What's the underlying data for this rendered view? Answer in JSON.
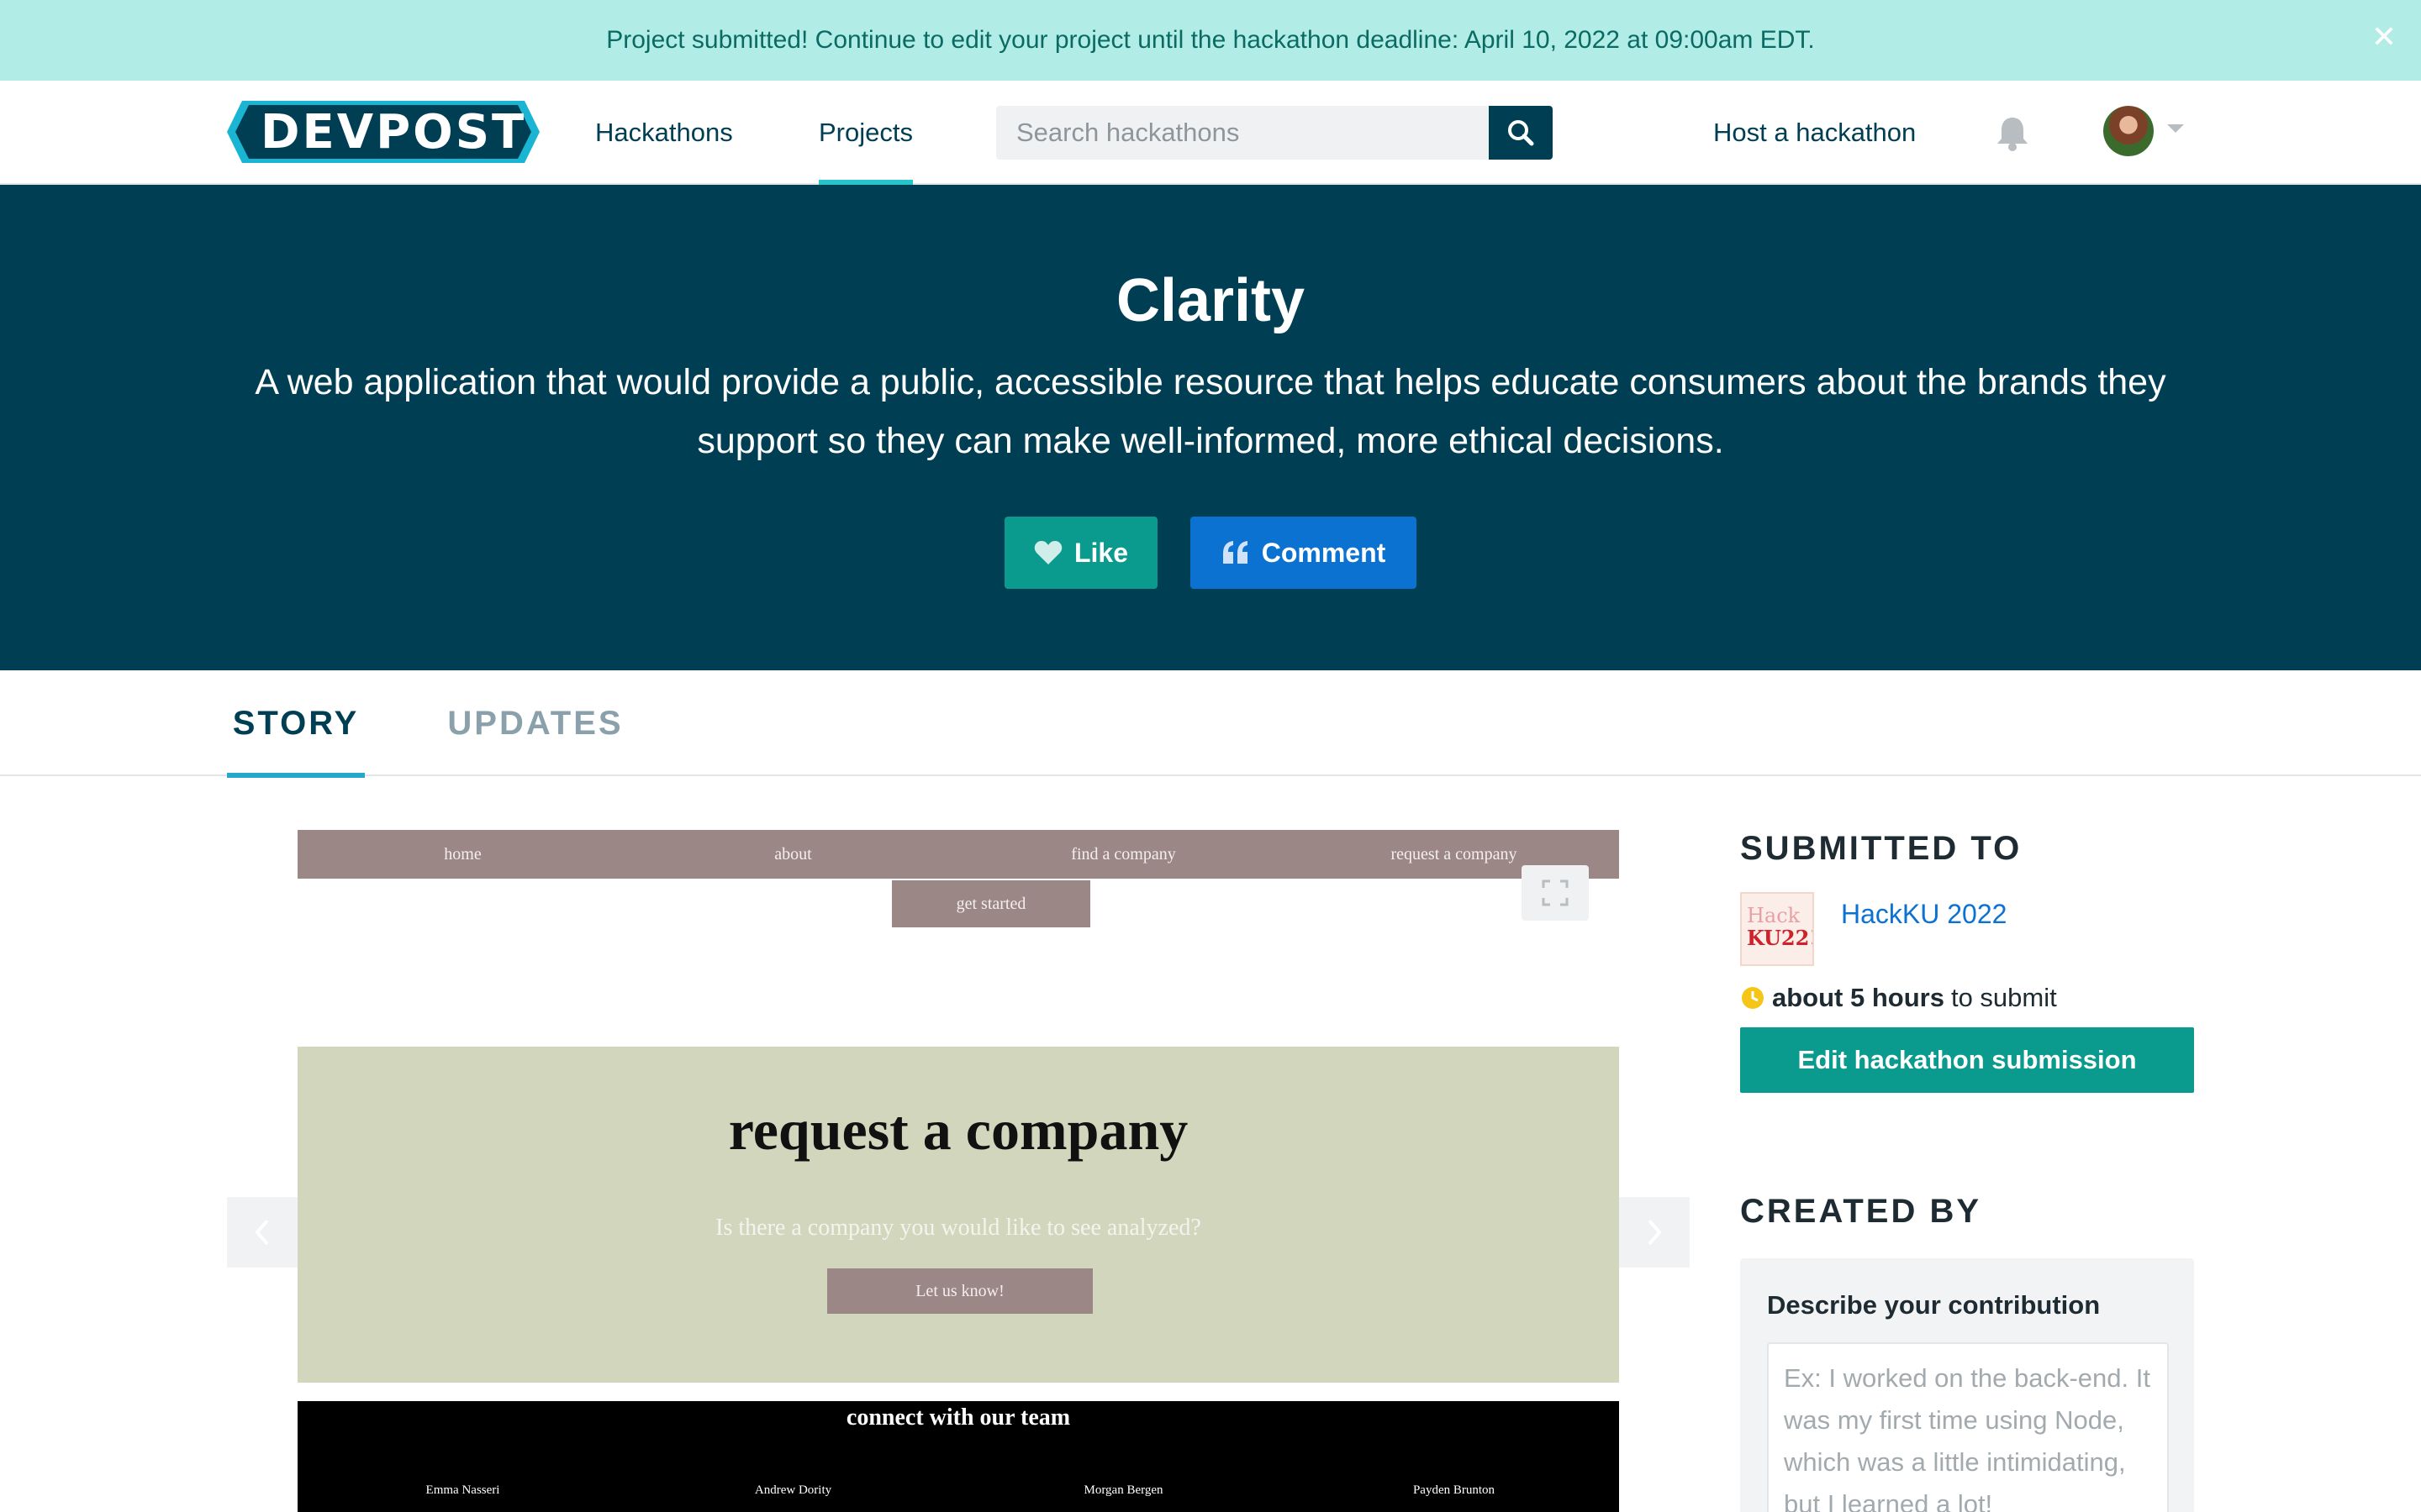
{
  "banner": {
    "message": "Project submitted! Continue to edit your project until the hackathon deadline: April 10, 2022 at 09:00am EDT.",
    "close_glyph": "✕"
  },
  "header": {
    "logo_text": "DEVPOST",
    "nav": {
      "hackathons": "Hackathons",
      "projects": "Projects"
    },
    "search_placeholder": "Search hackathons",
    "host_label": "Host a hackathon"
  },
  "hero": {
    "title": "Clarity",
    "tagline": "A web application that would provide a public, accessible resource that helps educate consumers about the brands they support so they can make well-informed, more ethical decisions.",
    "like_label": "Like",
    "comment_label": "Comment"
  },
  "tabs": {
    "story": "STORY",
    "updates": "UPDATES"
  },
  "gallery": {
    "screenshot": {
      "nav": [
        "home",
        "about",
        "find a company",
        "request a company"
      ],
      "get_started": "get started",
      "request_title": "request a company",
      "request_subtitle": "Is there a company you would like to see analyzed?",
      "request_button": "Let us know!",
      "team_title": "connect with our team",
      "team_members": [
        "Emma Nasseri",
        "Andrew Dority",
        "Morgan Bergen",
        "Payden Brunton"
      ]
    }
  },
  "sidebar": {
    "submitted_heading": "SUBMITTED TO",
    "hackathon_logo_lines": [
      "Hack",
      "KU22!"
    ],
    "hackathon_name": "HackKU 2022",
    "deadline_bold": "about 5 hours",
    "deadline_rest": "to submit",
    "edit_button": "Edit hackathon submission",
    "created_heading": "CREATED BY",
    "contribution_label": "Describe your contribution",
    "contribution_placeholder": "Ex: I worked on the back-end. It was my first time using Node, which was a little intimidating, but I learned a lot!"
  },
  "colors": {
    "banner_bg": "#b2ece7",
    "navy": "#003e54",
    "teal": "#0a9b8e",
    "blue": "#0b72d2",
    "accent_cyan": "#27c4cb"
  },
  "icons": [
    "close-icon",
    "search-icon",
    "bell-icon",
    "heart-icon",
    "quote-icon",
    "expand-icon",
    "chevron-left-icon",
    "chevron-right-icon",
    "clock-icon"
  ]
}
